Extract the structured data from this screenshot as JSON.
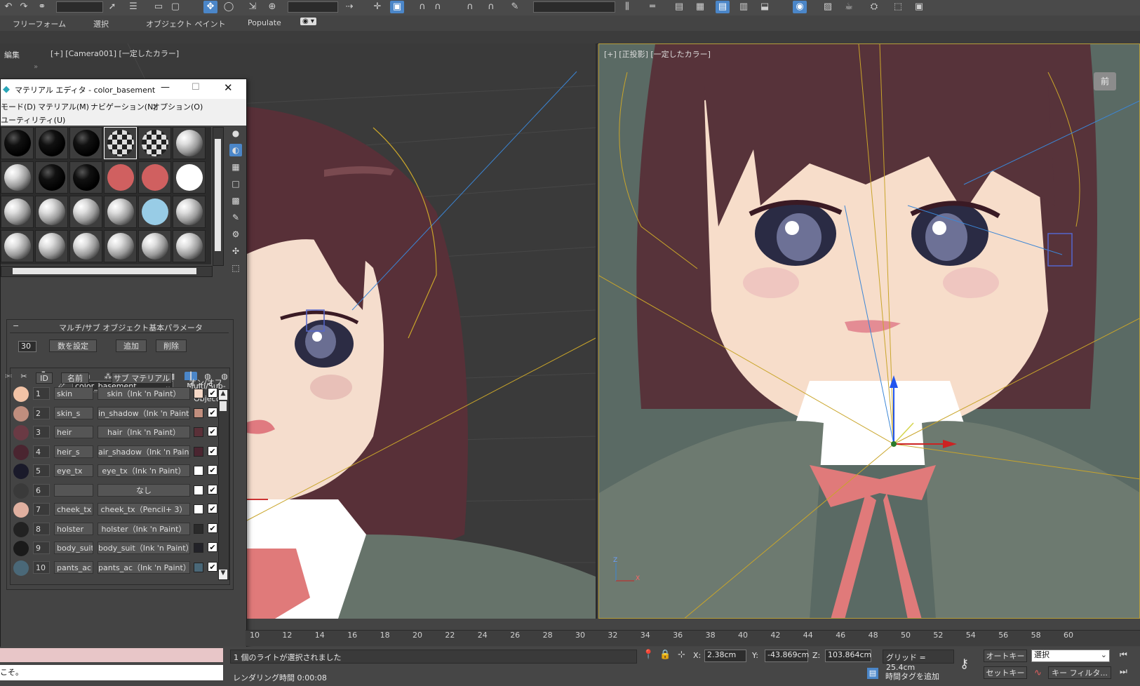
{
  "toolbar": {
    "icons": [
      "undo-icon",
      "redo-icon",
      "link-icon",
      "unlink-icon",
      "bind-icon",
      "select-icon",
      "select-by-name-icon",
      "rect-region-icon",
      "window-crossing-icon",
      "move-icon",
      "rotate-icon",
      "scale-icon",
      "pivot-icon",
      "select-manip-icon",
      "keyboard-shortcut-icon",
      "snap-icon",
      "angle-snap-icon",
      "percent-snap-icon",
      "spinner-snap-icon",
      "named-sel-icon",
      "mirror-icon",
      "align-icon",
      "layers-icon",
      "ribbon-icon",
      "curve-editor-icon",
      "schematic-icon",
      "material-editor-icon",
      "render-setup-icon",
      "render-frame-icon",
      "render-icon"
    ]
  },
  "ribbon": {
    "tabs": [
      "フリーフォーム",
      "選択",
      "オブジェクト ペイント",
      "Populate"
    ]
  },
  "command_panel": {
    "label": "編集"
  },
  "viewports": {
    "left_label": "[+] [Camera001] [一定したカラー]",
    "right_label": "[+] [正投影] [一定したカラー]",
    "viewcube_label": "前"
  },
  "material_editor": {
    "title": "マテリアル エディタ - color_basement",
    "menus_row1": [
      "モード(D)",
      "マテリアル(M)",
      "ナビゲーション(N)",
      "オプション(O)"
    ],
    "menus_row2": [
      "ユーティリティ(U)"
    ],
    "material_name": "color_basement",
    "material_type": "Multi/Sub-Object",
    "rollout_title": "マルチ/サブ オブジェクト基本パラメータ",
    "count_value": "30",
    "btn_set_count": "数を設定",
    "btn_add": "追加",
    "btn_delete": "削除",
    "col_id": "ID",
    "col_name": "名前",
    "col_sub": "サブ マテリアル",
    "col_onoff": "オン/オフ",
    "rows": [
      {
        "id": "1",
        "name": "skin",
        "sub": "skin（Ink 'n Paint）",
        "color": "#f6d9c8",
        "thumb": "#f2c3a6"
      },
      {
        "id": "2",
        "name": "skin_s",
        "sub": "in_shadow（Ink 'n Paint）",
        "color": "#c08e7e",
        "thumb": "#c08e7e"
      },
      {
        "id": "3",
        "name": "heir",
        "sub": "hair（Ink 'n Paint）",
        "color": "#5a3038",
        "thumb": "#6a3a44"
      },
      {
        "id": "4",
        "name": "heir_s",
        "sub": "air_shadow（Ink 'n Paint）",
        "color": "#4a2530",
        "thumb": "#4a2530"
      },
      {
        "id": "5",
        "name": "eye_tx",
        "sub": "eye_tx（Ink 'n Paint）",
        "color": "#ffffff",
        "thumb": "#1a1a2a"
      },
      {
        "id": "6",
        "name": "",
        "sub": "なし",
        "color": "#ffffff",
        "thumb": "#3a3a3a"
      },
      {
        "id": "7",
        "name": "cheek_tx",
        "sub": "cheek_tx（Pencil+ 3）",
        "color": "#ffffff",
        "thumb": "#e0b0a0"
      },
      {
        "id": "8",
        "name": "holster",
        "sub": "holster（Ink 'n Paint）",
        "color": "#2a2a2a",
        "thumb": "#222"
      },
      {
        "id": "9",
        "name": "body_suit",
        "sub": "body_suit（Ink 'n Paint）",
        "color": "#222228",
        "thumb": "#1a1a1a"
      },
      {
        "id": "10",
        "name": "pants_ac",
        "sub": "pants_ac（Ink 'n Paint）",
        "color": "#4a6878",
        "thumb": "#4a6878"
      }
    ]
  },
  "timeline": {
    "ticks": [
      "10",
      "12",
      "14",
      "16",
      "18",
      "20",
      "22",
      "24",
      "26",
      "28",
      "30",
      "32",
      "34",
      "36",
      "38",
      "40",
      "42",
      "44",
      "46",
      "48",
      "50",
      "52",
      "54",
      "56",
      "58",
      "60"
    ]
  },
  "status": {
    "message": "1 個のライトが選択されました",
    "render_time": "レンダリング時間  0:00:08",
    "x_label": "X:",
    "x_value": "2.38cm",
    "y_label": "Y:",
    "y_value": "-43.869cm",
    "z_label": "Z:",
    "z_value": "103.864cm",
    "grid": "グリッド = 25.4cm",
    "add_time_tag": "時間タグを追加",
    "auto_key": "オートキー",
    "set_key": "セットキー",
    "selection": "選択",
    "key_filter": "キー フィルタ...",
    "maxscript_text": "こそ。"
  },
  "colors": {
    "accent": "#4b86c8",
    "viewport_bg": "#3a3a3a",
    "active_viewport_border": "#b59d3a"
  }
}
